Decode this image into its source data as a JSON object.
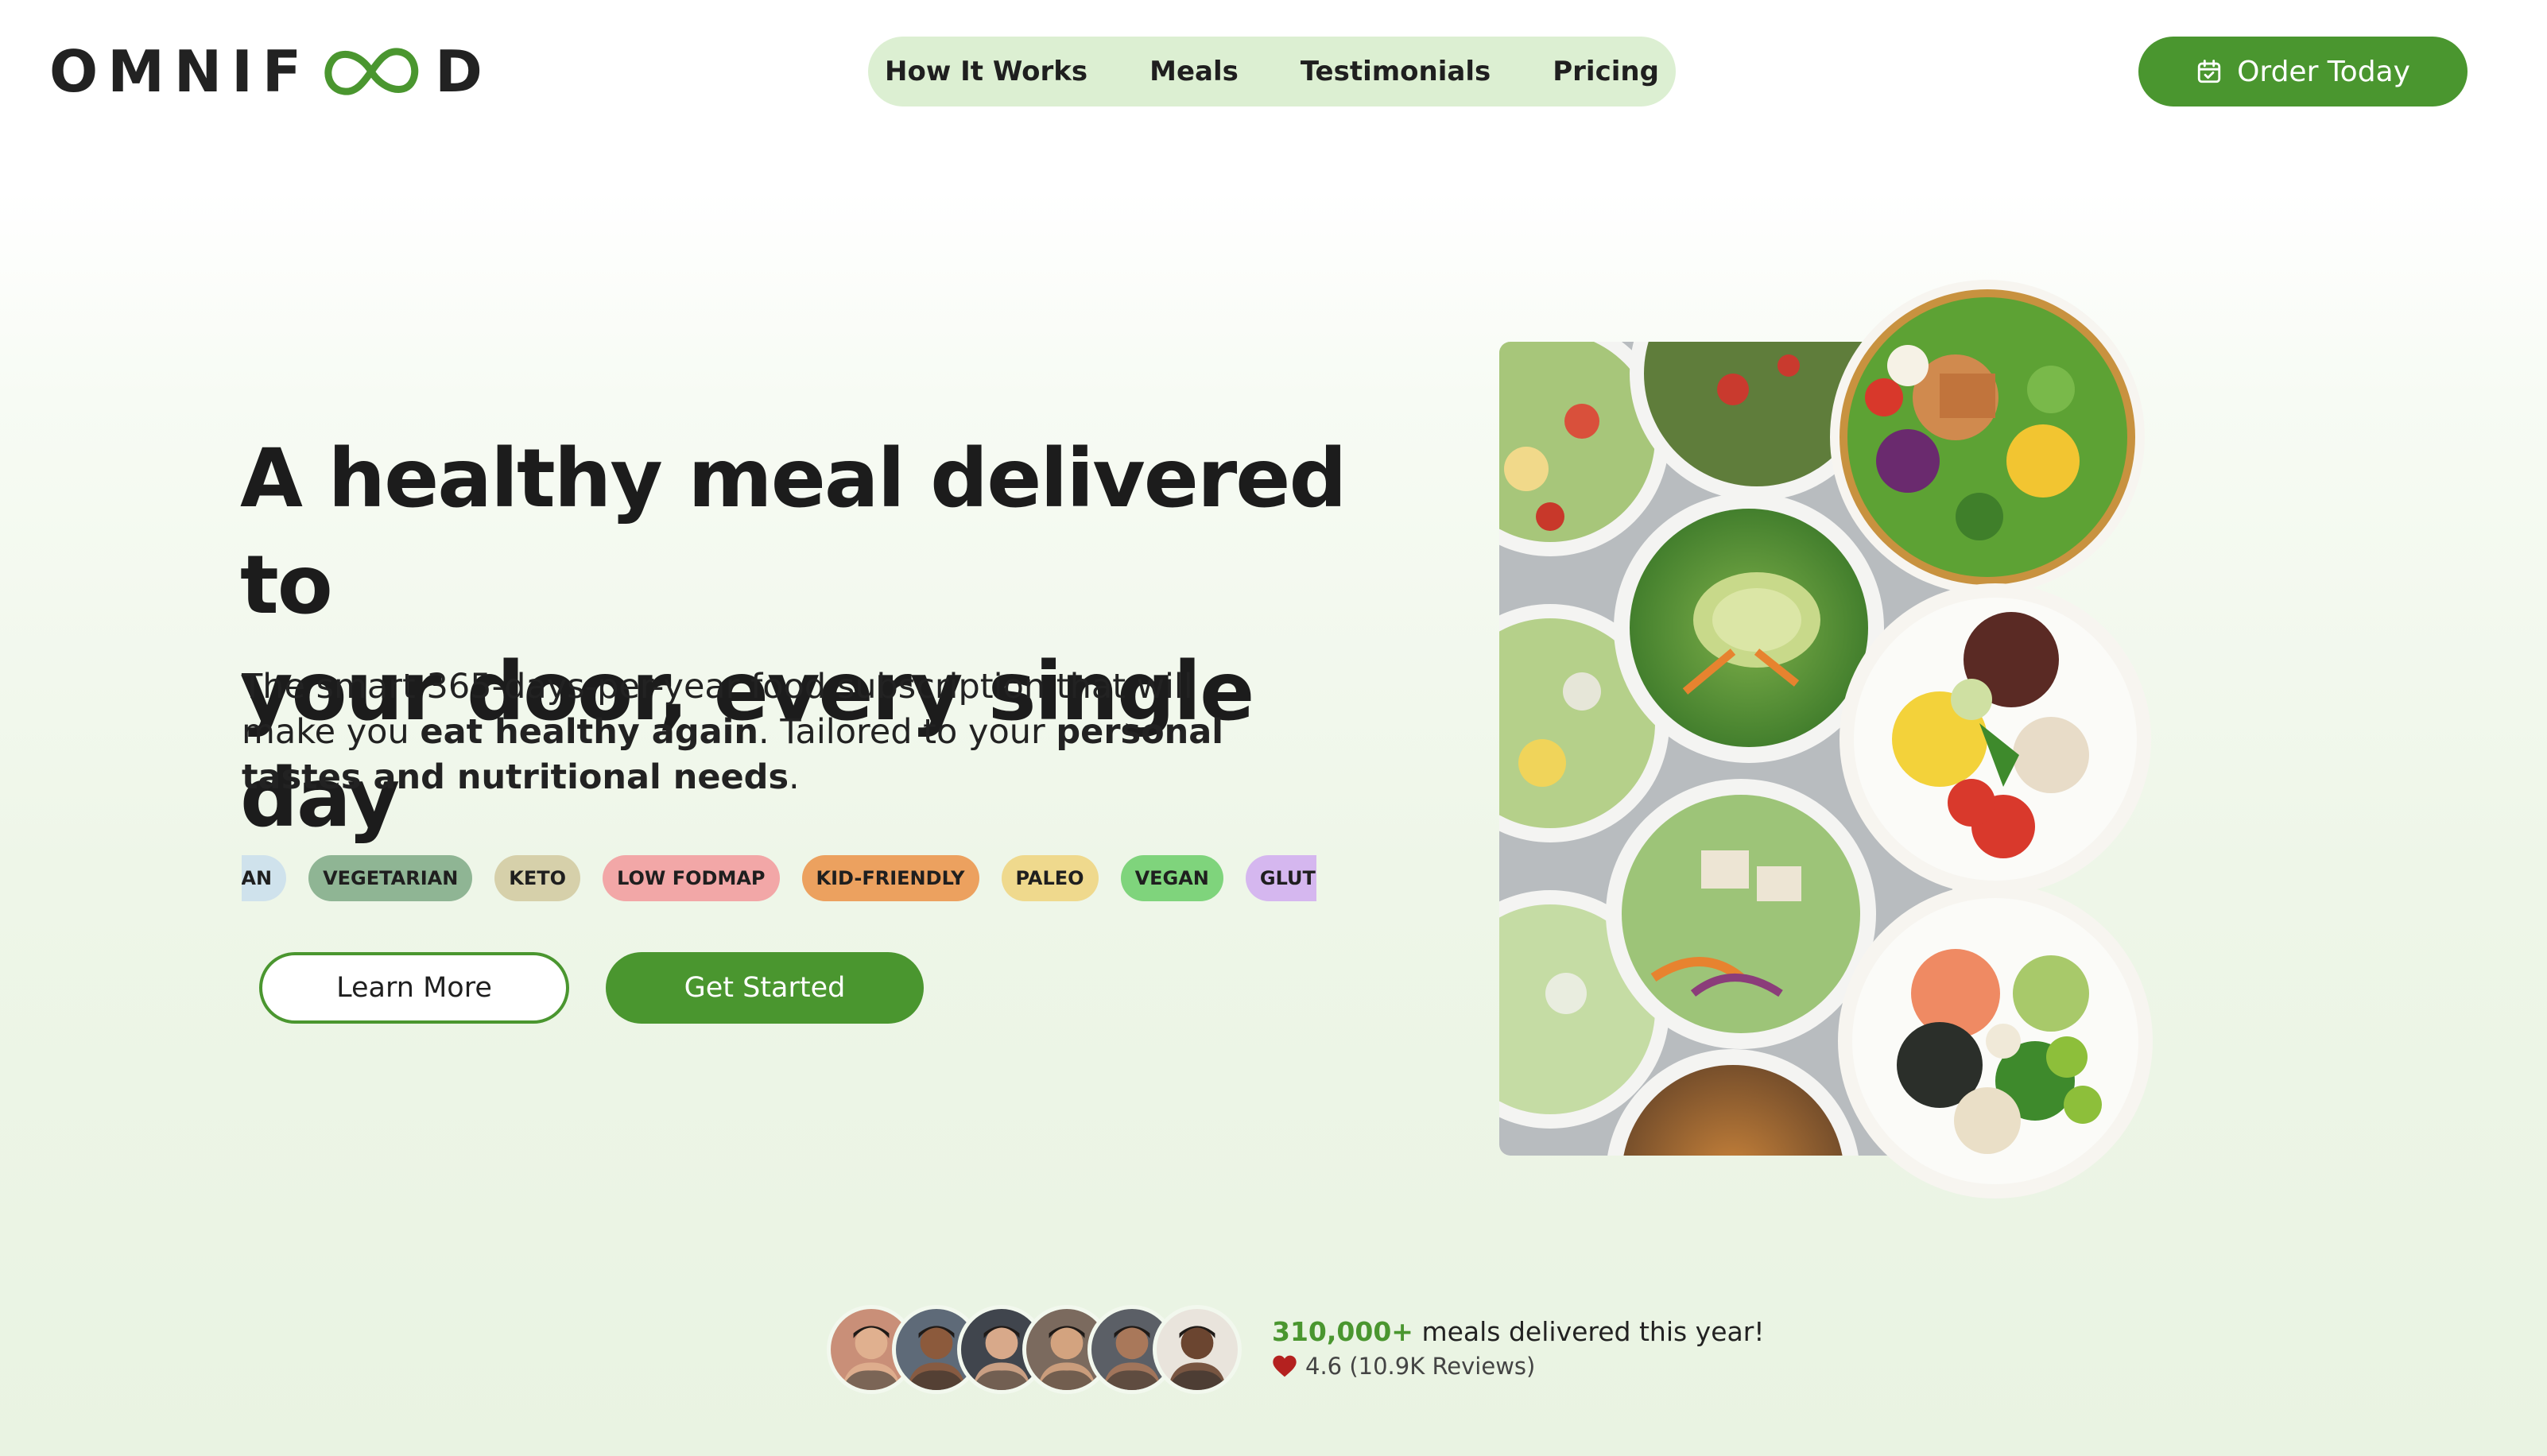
{
  "brand": {
    "logo_prefix": "OMNIF",
    "logo_suffix": "D",
    "accent_color": "#4a962f"
  },
  "nav": {
    "items": [
      {
        "label": "How It Works"
      },
      {
        "label": "Meals"
      },
      {
        "label": "Testimonials"
      },
      {
        "label": "Pricing"
      }
    ],
    "background_color": "#dcefd2"
  },
  "order_button": {
    "label": "Order Today",
    "icon": "calendar-check-icon"
  },
  "hero": {
    "title_line1": "A healthy meal delivered to",
    "title_line2": "your door, every single day",
    "subtitle_part1": "The smart 365-days-per-year food subscription that will make you ",
    "subtitle_bold1": "eat healthy again",
    "subtitle_part2": ". Tailored to your ",
    "subtitle_bold2": "personal tastes and nutritional needs",
    "subtitle_part3": "."
  },
  "tags": [
    {
      "label": "RIAN",
      "color": "#cfe2ec"
    },
    {
      "label": "VEGETARIAN",
      "color": "#8fb594"
    },
    {
      "label": "KETO",
      "color": "#d6d0aa"
    },
    {
      "label": "LOW FODMAP",
      "color": "#f2a7a7"
    },
    {
      "label": "KID-FRIENDLY",
      "color": "#eca15f"
    },
    {
      "label": "PALEO",
      "color": "#efd98d"
    },
    {
      "label": "VEGAN",
      "color": "#7fd47c"
    },
    {
      "label": "GLUTEN-FREE",
      "color": "#d5b7ef"
    }
  ],
  "buttons": {
    "learn_more": "Learn More",
    "get_started": "Get Started"
  },
  "hero_image": {
    "icon": "food-bowls-image"
  },
  "social_proof": {
    "count": "310,000+",
    "count_text": " meals delivered this year!",
    "rating_text": "4.6 (10.9K Reviews)",
    "rating_icon": "heart-icon",
    "avatars": [
      {
        "name": "customer-avatar-1",
        "bg": "#c98f78",
        "skin": "#e0b08f"
      },
      {
        "name": "customer-avatar-2",
        "bg": "#5e6a78",
        "skin": "#8c5a3c"
      },
      {
        "name": "customer-avatar-3",
        "bg": "#40454d",
        "skin": "#d8a98a"
      },
      {
        "name": "customer-avatar-4",
        "bg": "#7b6a5e",
        "skin": "#d3a37f"
      },
      {
        "name": "customer-avatar-5",
        "bg": "#5b5f66",
        "skin": "#a9785a"
      },
      {
        "name": "customer-avatar-6",
        "bg": "#e9e4dc",
        "skin": "#6b4530"
      }
    ]
  }
}
